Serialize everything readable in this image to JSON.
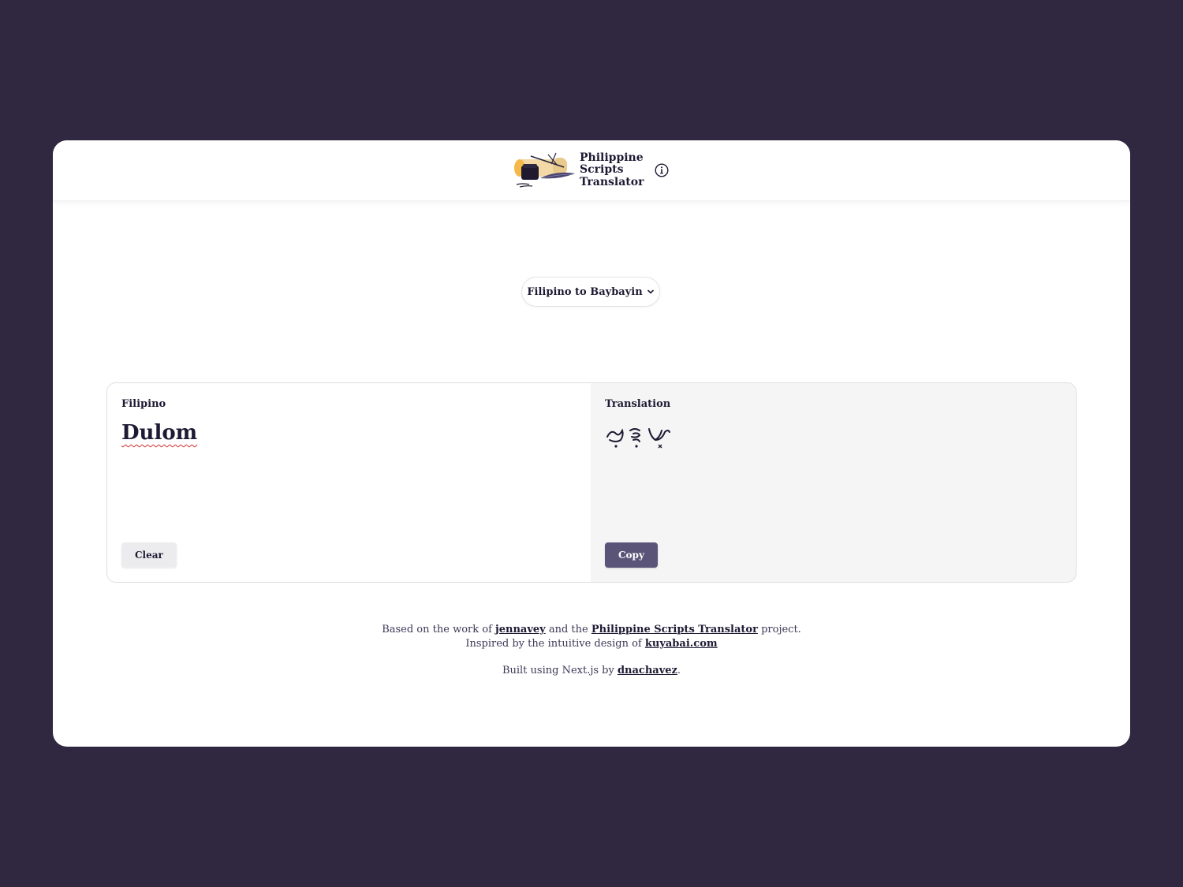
{
  "header": {
    "title_lines": [
      "Philippine",
      "Scripts",
      "Translator"
    ],
    "info_icon": "info-circle-icon"
  },
  "mode": {
    "selected": "Filipino to Baybayin",
    "chevron_icon": "chevron-down-icon"
  },
  "input_panel": {
    "label": "Filipino",
    "value": "Dulom",
    "clear_label": "Clear"
  },
  "output_panel": {
    "label": "Translation",
    "copy_label": "Copy"
  },
  "footer": {
    "line1_a": "Based on the work of ",
    "line1_link1": "jennavey",
    "line1_b": " and the ",
    "line1_link2": "Philippine Scripts Translator",
    "line1_c": " project.",
    "line2_a": "Inspired by the intuitive design of ",
    "line2_link": "kuyabai.com",
    "line3_a": "Built using Next.js by ",
    "line3_link": "dnachavez",
    "line3_b": "."
  },
  "colors": {
    "background": "#302840",
    "accent": "#5a5478",
    "text": "#1e1a33"
  }
}
